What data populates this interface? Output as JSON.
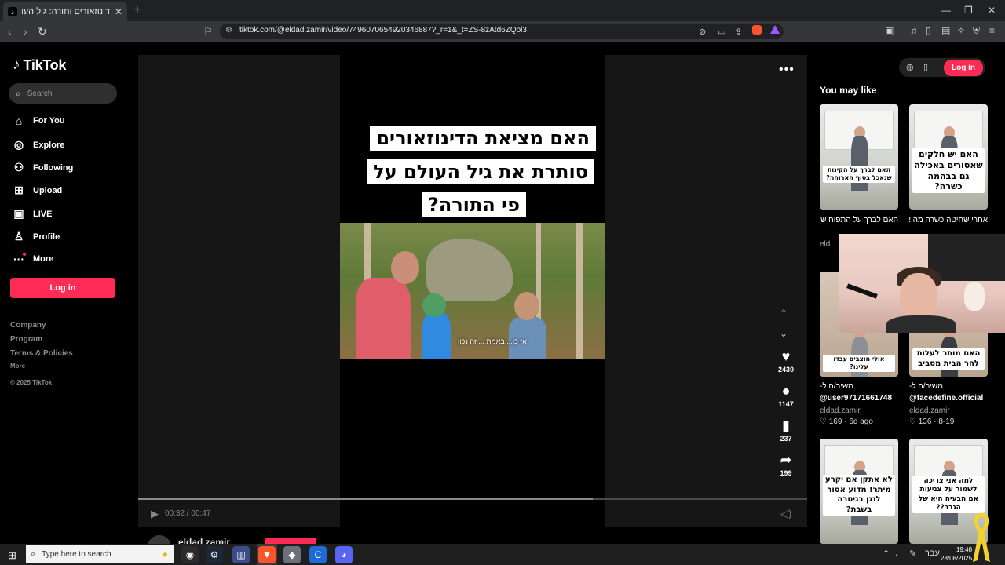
{
  "browser": {
    "tab_title": "דינוזאורים ותורה: גיל העולם לפי",
    "tab_close": "✕",
    "new_tab": "+",
    "url": "tiktok.com/@eldad.zamir/video/7496070654920346887?_r=1&_t=ZS-8zAtd6ZQol3",
    "window_controls": [
      "—",
      "❐",
      "✕"
    ]
  },
  "tiktok": {
    "logo_text": "TikTok",
    "search_placeholder": "Search",
    "nav": [
      {
        "icon": "home-icon",
        "label": "For You"
      },
      {
        "icon": "compass-icon",
        "label": "Explore"
      },
      {
        "icon": "following-icon",
        "label": "Following"
      },
      {
        "icon": "upload-icon",
        "label": "Upload"
      },
      {
        "icon": "live-icon",
        "label": "LIVE"
      },
      {
        "icon": "profile-icon",
        "label": "Profile"
      },
      {
        "icon": "more-icon",
        "label": "More"
      }
    ],
    "login_label": "Log in",
    "footer_links": [
      "Company",
      "Program",
      "Terms & Policies"
    ],
    "footer_more": "More",
    "copyright": "© 2025 TikTok"
  },
  "video": {
    "caption_lines": [
      "האם מציאת הדינוזאורים",
      "סותרת את גיל העולם על",
      "פי התורה?"
    ],
    "subtitle": "אז כן... באמת ... זה נכון",
    "likes": "2430",
    "comments": "1147",
    "saves": "237",
    "shares": "199",
    "time": "00:32 / 00:47",
    "progress": 0.68,
    "author": "eldad.zamir"
  },
  "right": {
    "login_label": "Log in",
    "heading": "You may like",
    "items": [
      {
        "thumb_text": "האם לברך על הקינוח שנאכל בסוף הארוחה?",
        "caption": "האם לברך על התפוח שבסוף הסעודה?",
        "author": "eld"
      },
      {
        "thumb_text": "האם יש חלקים שאסורים באכילה גם בבהמה כשרה?",
        "caption": "אחרי שחיטה כשרה מה אסור באכילה בבהמה?",
        "author": ""
      },
      {
        "thumb_text": "אולי חוצבים עבדו עלינו?",
        "caption": "-משיב/ה ל",
        "sub": "@user97171661748",
        "author": "eldad.zamir",
        "stats": "♡ 169 · 6d ago"
      },
      {
        "thumb_text": "האם מותר לעלות להר הבית מסביב",
        "caption": "-משיב/ה ל",
        "sub": "@facedefine.official",
        "author": "eldad.zamir",
        "stats": "♡ 136 · 8-19"
      },
      {
        "thumb_text": "לא אתקן אם יקרע מיתר! מדוע אסור לנגן בגיטרה בשבת?",
        "caption": "",
        "author": ""
      },
      {
        "thumb_text": "למה אני צריכה לשמור על צניעות אם הבעיה היא של הגבר??",
        "caption": "",
        "author": ""
      }
    ]
  },
  "taskbar": {
    "search_placeholder": "Type here to search",
    "lang": "עבר",
    "time": "19:48",
    "date": "28/08/2025"
  },
  "colors": {
    "accent": "#fe2c55",
    "background": "#000000",
    "player_bg": "#161616"
  }
}
